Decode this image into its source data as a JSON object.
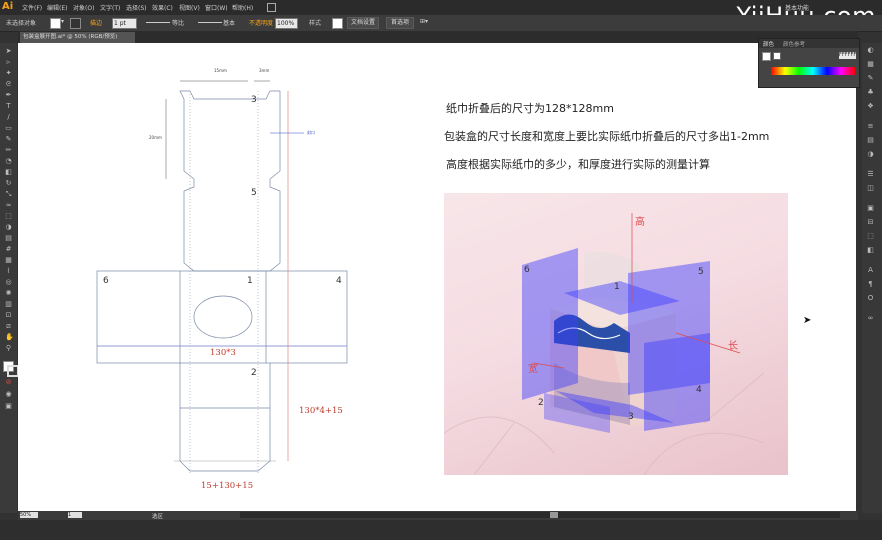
{
  "app": {
    "logo": "Ai",
    "watermark": "YiiHuu.com"
  },
  "menu": [
    "文件(F)",
    "编辑(E)",
    "对象(O)",
    "文字(T)",
    "选择(S)",
    "效果(C)",
    "视图(V)",
    "窗口(W)",
    "帮助(H)"
  ],
  "menu_right": "基本功能",
  "control_bar": {
    "selection": "未选择对象",
    "stroke_label": "描边",
    "stroke_value": "1 pt",
    "uniform": "等比",
    "basic": "基本",
    "opacity_label": "不透明度",
    "opacity_value": "100%",
    "style_label": "样式",
    "doc_setup": "文档设置",
    "prefs": "首选项"
  },
  "doc_tab": "包装盒展开图.ai* @ 50% (RGB/预览)",
  "status": {
    "zoom": "50%",
    "page": "1",
    "state": "选区"
  },
  "color_panel": {
    "tab1": "颜色",
    "tab2": "颜色参考",
    "hex": "FFFFFF"
  },
  "notes": [
    "纸巾折叠后的尺寸为128*128mm",
    "包装盒的尺寸长度和宽度上要比实际纸巾折叠后的尺寸多出1-2mm",
    "高度根据实际纸巾的多少，和厚度进行实际的测量计算"
  ],
  "dieline": {
    "top_dim_left": "15mm",
    "top_dim_right": "3mm",
    "side_dim": "20mm",
    "tag": "封口",
    "panel_numbers": [
      "3",
      "5",
      "6",
      "1",
      "4",
      "2"
    ],
    "mid_label": "130*3",
    "right_label": "130*4+15",
    "bottom_label": "15+130+15"
  },
  "photo": {
    "axis_height": "高",
    "axis_length": "长",
    "axis_width": "宽",
    "numbers": [
      "6",
      "5",
      "1",
      "4",
      "2",
      "3"
    ]
  },
  "colors": {
    "accent": "#f7a21b",
    "dim_red": "#c0392b",
    "blue_panel": "#3c3cff"
  }
}
